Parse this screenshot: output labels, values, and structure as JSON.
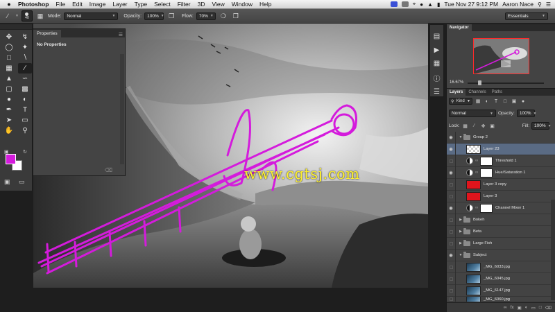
{
  "menubar": {
    "app_name": "Photoshop",
    "items": [
      "File",
      "Edit",
      "Image",
      "Layer",
      "Type",
      "Select",
      "Filter",
      "3D",
      "View",
      "Window",
      "Help"
    ],
    "datetime": "Tue Nov 27  9:12 PM",
    "user": "Aaron Nace"
  },
  "options": {
    "brush_size": "48",
    "mode_label": "Mode:",
    "mode_value": "Normal",
    "opacity_label": "Opacity:",
    "opacity_value": "100%",
    "flow_label": "Flow:",
    "flow_value": "70%",
    "workspace": "Essentials"
  },
  "properties": {
    "tab": "Properties",
    "title": "No Properties"
  },
  "watermark": "www.cgtsj.com",
  "colors": {
    "foreground": "#d41bdc",
    "background": "#ffffff",
    "selection": "#5a6b84"
  },
  "navigator": {
    "tab": "Navigator",
    "zoom": "16.67%"
  },
  "layers_panel": {
    "tabs": [
      "Layers",
      "Channels",
      "Paths"
    ],
    "filter": "Kind",
    "blend_mode": "Normal",
    "opacity_label": "Opacity:",
    "opacity_value": "100%",
    "lock_label": "Lock:",
    "fill_label": "Fill:",
    "fill_value": "100%",
    "layers": [
      {
        "name": "Group 2"
      },
      {
        "name": "Layer 23"
      },
      {
        "name": "Threshold 1"
      },
      {
        "name": "Hue/Saturation 1"
      },
      {
        "name": "Layer 3 copy"
      },
      {
        "name": "Layer 3"
      },
      {
        "name": "Channel Mixer 1"
      },
      {
        "name": "Bokeh"
      },
      {
        "name": "Beta"
      },
      {
        "name": "Large Fish"
      },
      {
        "name": "Subject"
      },
      {
        "name": "_MG_6033.jpg"
      },
      {
        "name": "_MG_6045.jpg"
      },
      {
        "name": "_MG_6147.jpg"
      },
      {
        "name": "_MG_6060.jpg"
      }
    ]
  }
}
